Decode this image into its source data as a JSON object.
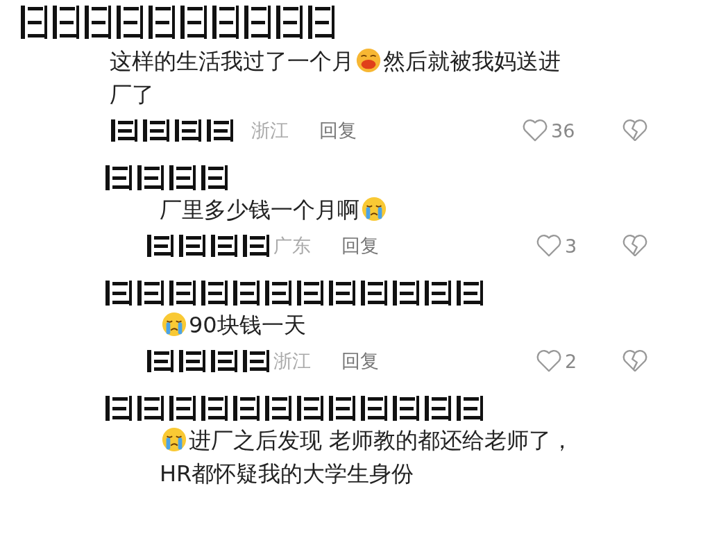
{
  "comments": [
    {
      "kind": "top",
      "parts": [
        {
          "kind": "text",
          "text": "这样的生活我过了一个月"
        },
        {
          "kind": "laugh"
        },
        {
          "kind": "text",
          "text": "然后就被我妈送进"
        },
        {
          "kind": "line",
          "text": "厂了"
        }
      ],
      "location": "浙江",
      "reply": "回复",
      "likes": "36"
    },
    {
      "kind": "reply",
      "parts": [
        {
          "kind": "text",
          "text": "厂里多少钱一个月啊"
        },
        {
          "kind": "cry"
        }
      ],
      "location": "广东",
      "reply": "回复",
      "likes": "3"
    },
    {
      "kind": "reply",
      "parts": [
        {
          "kind": "cry"
        },
        {
          "kind": "text",
          "text": "90块钱一天"
        }
      ],
      "location": "浙江",
      "reply": "回复",
      "likes": "2"
    },
    {
      "kind": "reply",
      "parts": [
        {
          "kind": "cry"
        },
        {
          "kind": "text",
          "text": "进厂之后发现 老师教的都还给老师了，"
        },
        {
          "kind": "line",
          "text": "HR都怀疑我的大学生身份"
        }
      ]
    }
  ]
}
